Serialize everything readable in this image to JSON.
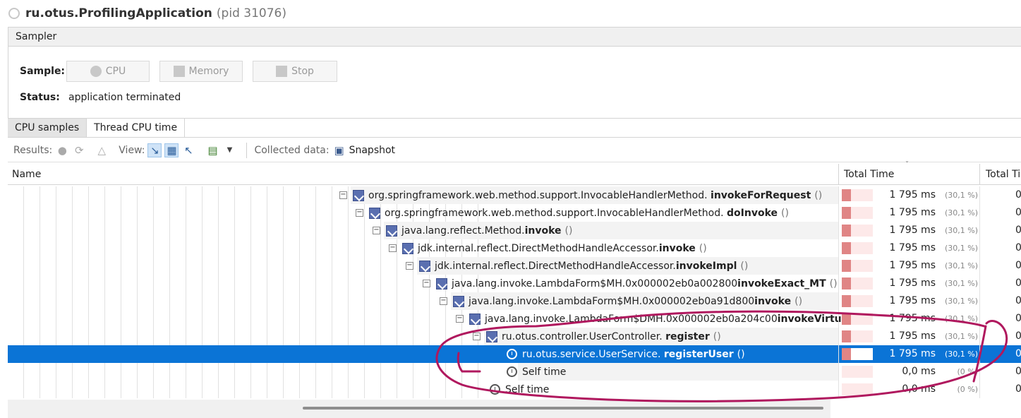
{
  "window": {
    "app_name": "ru.otus.ProfilingApplication",
    "pid_text": "(pid 31076)"
  },
  "sampler": {
    "tab_label": "Sampler",
    "sample_label": "Sample:",
    "buttons": {
      "cpu": "CPU",
      "memory": "Memory",
      "stop": "Stop"
    },
    "status_label": "Status:",
    "status_value": "application terminated"
  },
  "tabs": [
    {
      "label": "CPU samples",
      "active": true
    },
    {
      "label": "Thread CPU time",
      "active": false
    }
  ],
  "toolbar": {
    "results_label": "Results:",
    "view_label": "View:",
    "collected_label": "Collected data:",
    "snapshot_label": "Snapshot"
  },
  "table": {
    "col_name": "Name",
    "col_total": "Total Time",
    "col_total2": "Total Time (CPU)",
    "rows": [
      {
        "cls": "org.springframework.web.method.support.InvocableHandlerMethod.",
        "method": "invokeForRequest",
        "parens": "()",
        "ms": "1 795 ms",
        "pct": "(30,1 %)",
        "fill": 0.3,
        "col2": "0"
      },
      {
        "cls": "org.springframework.web.method.support.InvocableHandlerMethod.",
        "method": "doInvoke",
        "parens": "()",
        "ms": "1 795 ms",
        "pct": "(30,1 %)",
        "fill": 0.3,
        "col2": "0"
      },
      {
        "cls": "java.lang.reflect.Method.",
        "method": "invoke",
        "parens": "()",
        "ms": "1 795 ms",
        "pct": "(30,1 %)",
        "fill": 0.3,
        "col2": "0"
      },
      {
        "cls": "jdk.internal.reflect.DirectMethodHandleAccessor.",
        "method": "invoke",
        "parens": "()",
        "ms": "1 795 ms",
        "pct": "(30,1 %)",
        "fill": 0.3,
        "col2": "0"
      },
      {
        "cls": "jdk.internal.reflect.DirectMethodHandleAccessor.",
        "method": "invokeImpl",
        "parens": "()",
        "ms": "1 795 ms",
        "pct": "(30,1 %)",
        "fill": 0.3,
        "col2": "0"
      },
      {
        "cls": "java.lang.invoke.LambdaForm$MH.0x000002eb0a002800",
        "method": "invokeExact_MT",
        "parens": "()",
        "ms": "1 795 ms",
        "pct": "(30,1 %)",
        "fill": 0.3,
        "col2": "0"
      },
      {
        "cls": "java.lang.invoke.LambdaForm$MH.0x000002eb0a91d800",
        "method": "invoke",
        "parens": "()",
        "ms": "1 795 ms",
        "pct": "(30,1 %)",
        "fill": 0.3,
        "col2": "0"
      },
      {
        "cls": "java.lang.invoke.LambdaForm$DMH.0x000002eb0a204c00",
        "method": "invokeVirtual",
        "parens": "()",
        "ms": "1 795 ms",
        "pct": "(30,1 %)",
        "fill": 0.3,
        "col2": "0"
      },
      {
        "cls": "ru.otus.controller.UserController.",
        "method": "register",
        "parens": "()",
        "ms": "1 795 ms",
        "pct": "(30,1 %)",
        "fill": 0.3,
        "col2": "0"
      },
      {
        "cls": "ru.otus.service.UserService.",
        "method": "registerUser",
        "parens": "()",
        "ms": "1 795 ms",
        "pct": "(30,1 %)",
        "fill": 0.3,
        "col2": "0"
      },
      {
        "self": "Self time",
        "ms": "0,0 ms",
        "pct": "(0 %)",
        "fill": 0.0,
        "col2": "0"
      },
      {
        "self": "Self time",
        "ms": "0,0 ms",
        "pct": "(0 %)",
        "fill": 0.0,
        "col2": "0"
      }
    ]
  },
  "colors": {
    "selection": "#0b74d6",
    "bar_fill": "#e08585",
    "bar_bg": "#fde9e9",
    "annotation": "#b0185e"
  }
}
